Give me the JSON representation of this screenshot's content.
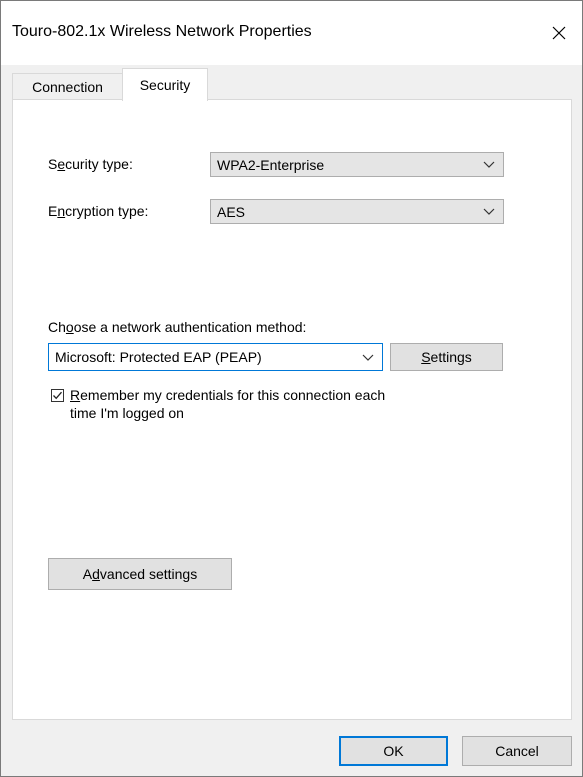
{
  "window": {
    "title": "Touro-802.1x Wireless Network Properties"
  },
  "tabs": [
    {
      "label": "Connection",
      "selected": false
    },
    {
      "label": "Security",
      "selected": true
    }
  ],
  "security": {
    "security_type_label_pre": "S",
    "security_type_label_ul": "e",
    "security_type_label_post": "curity type:",
    "security_type_value": "WPA2-Enterprise",
    "encryption_type_label_pre": "E",
    "encryption_type_label_ul": "n",
    "encryption_type_label_post": "cryption type:",
    "encryption_type_value": "AES",
    "auth_method_label_pre": "Ch",
    "auth_method_label_ul": "o",
    "auth_method_label_post": "ose a network authentication method:",
    "auth_method_value": "Microsoft: Protected EAP (PEAP)",
    "settings_button_ul": "S",
    "settings_button_rest": "ettings",
    "remember_checked": true,
    "remember_line1_ul": "R",
    "remember_line1_rest": "emember my credentials for this connection each",
    "remember_line2": "time I'm logged on",
    "advanced_button_pre": "A",
    "advanced_button_ul": "d",
    "advanced_button_post": "vanced settings"
  },
  "footer": {
    "ok_label": "OK",
    "cancel_label": "Cancel"
  },
  "colors": {
    "accent": "#0078d7",
    "window_bg": "#f0f0f0",
    "panel_bg": "#ffffff",
    "combo_bg": "#e5e5e5",
    "button_bg": "#e1e1e1"
  },
  "icons": {
    "close": "close-icon",
    "chevron": "chevron-down-icon",
    "check": "checkmark-icon"
  }
}
